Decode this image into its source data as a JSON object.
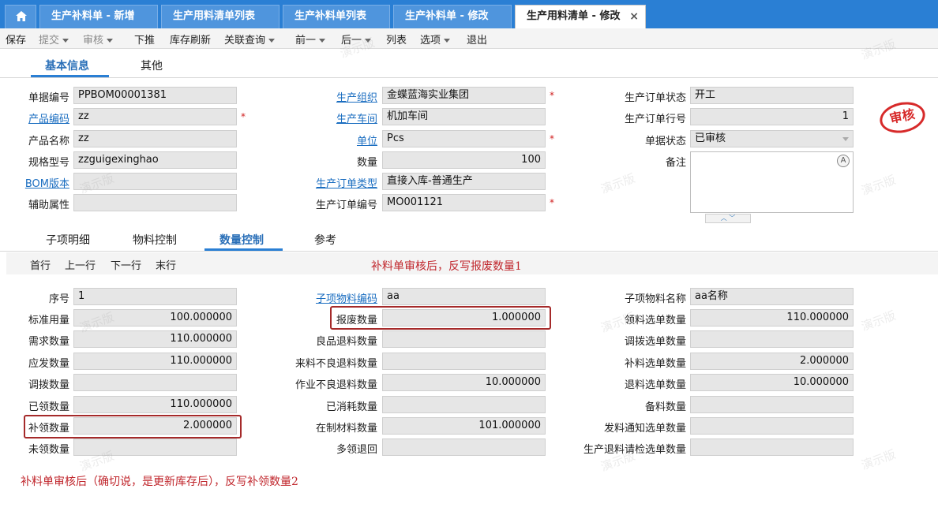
{
  "tabs": [
    {
      "label": "生产补料单 - 新增"
    },
    {
      "label": "生产用料清单列表"
    },
    {
      "label": "生产补料单列表"
    },
    {
      "label": "生产补料单 - 修改"
    },
    {
      "label": "生产用料清单 - 修改",
      "close": "×"
    }
  ],
  "toolbar": {
    "save": "保存",
    "submit": "提交",
    "audit": "审核",
    "push": "下推",
    "refresh_stock": "库存刷新",
    "related_query": "关联查询",
    "prev": "前一",
    "next": "后一",
    "list": "列表",
    "options": "选项",
    "exit": "退出"
  },
  "header_tabs": {
    "basic": "基本信息",
    "other": "其他"
  },
  "basic": {
    "bill_no_label": "单据编号",
    "bill_no": "PPBOM00001381",
    "product_code_label": "产品编码",
    "product_code": "zz",
    "product_name_label": "产品名称",
    "product_name": "zz",
    "spec_label": "规格型号",
    "spec": "zzguigexinghao",
    "bom_label": "BOM版本",
    "bom": "",
    "aux_label": "辅助属性",
    "aux": "",
    "org_label": "生产组织",
    "org": "金蝶蓝海实业集团",
    "workshop_label": "生产车间",
    "workshop": "机加车间",
    "unit_label": "单位",
    "unit": "Pcs",
    "qty_label": "数量",
    "qty": "100",
    "mo_type_label": "生产订单类型",
    "mo_type": "直接入库-普通生产",
    "mo_no_label": "生产订单编号",
    "mo_no": "MO001121",
    "mo_status_label": "生产订单状态",
    "mo_status": "开工",
    "mo_line_label": "生产订单行号",
    "mo_line": "1",
    "doc_status_label": "单据状态",
    "doc_status": "已审核",
    "remark_label": "备注",
    "stamp": "审核",
    "required_mark": "*"
  },
  "detail_tabs": {
    "items": "子项明细",
    "material": "物料控制",
    "qty": "数量控制",
    "ref": "参考"
  },
  "nav": {
    "first": "首行",
    "prev": "上一行",
    "next": "下一行",
    "last": "末行"
  },
  "annotations": {
    "top": "补料单审核后，反写报废数量1",
    "bottom": "补料单审核后（确切说，是更新库存后），反写补领数量2"
  },
  "qty": {
    "seq_label": "序号",
    "seq": "1",
    "std_label": "标准用量",
    "std": "100.000000",
    "need_label": "需求数量",
    "need": "110.000000",
    "due_label": "应发数量",
    "due": "110.000000",
    "transfer_label": "调拨数量",
    "transfer": "",
    "picked_label": "已领数量",
    "picked": "110.000000",
    "repick_label": "补领数量",
    "repick": "2.000000",
    "unpicked_label": "未领数量",
    "unpicked": "",
    "sub_code_label": "子项物料编码",
    "sub_code": "aa",
    "scrap_label": "报废数量",
    "scrap": "1.000000",
    "good_return_label": "良品退料数量",
    "good_return": "",
    "incoming_bad_label": "来料不良退料数量",
    "incoming_bad": "",
    "work_bad_label": "作业不良退料数量",
    "work_bad": "10.000000",
    "consumed_label": "已消耗数量",
    "consumed": "",
    "wip_label": "在制材料数量",
    "wip": "101.000000",
    "over_return_label": "多领退回",
    "over_return": "",
    "sub_name_label": "子项物料名称",
    "sub_name": "aa名称",
    "pick_sel_label": "领料选单数量",
    "pick_sel": "110.000000",
    "transfer_sel_label": "调拨选单数量",
    "transfer_sel": "",
    "feed_sel_label": "补料选单数量",
    "feed_sel": "2.000000",
    "return_sel_label": "退料选单数量",
    "return_sel": "10.000000",
    "prep_label": "备料数量",
    "prep": "",
    "notice_sel_label": "发料通知选单数量",
    "notice_sel": "",
    "inspect_sel_label": "生产退料请检选单数量",
    "inspect_sel": ""
  },
  "watermark": "演示版"
}
